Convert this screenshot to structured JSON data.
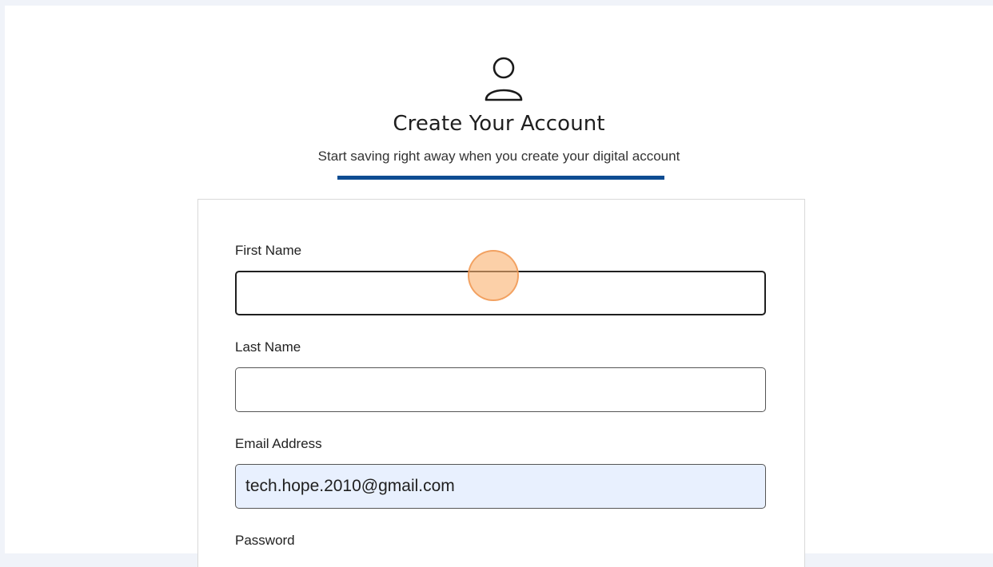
{
  "header": {
    "icon": "user-icon",
    "title": "Create Your Account",
    "subtitle": "Start saving right away when you create your digital account",
    "accent_color": "#0e4c92"
  },
  "form": {
    "first_name": {
      "label": "First Name",
      "value": ""
    },
    "last_name": {
      "label": "Last Name",
      "value": ""
    },
    "email": {
      "label": "Email Address",
      "value": "tech.hope.2010@gmail.com"
    },
    "password": {
      "label": "Password"
    }
  }
}
